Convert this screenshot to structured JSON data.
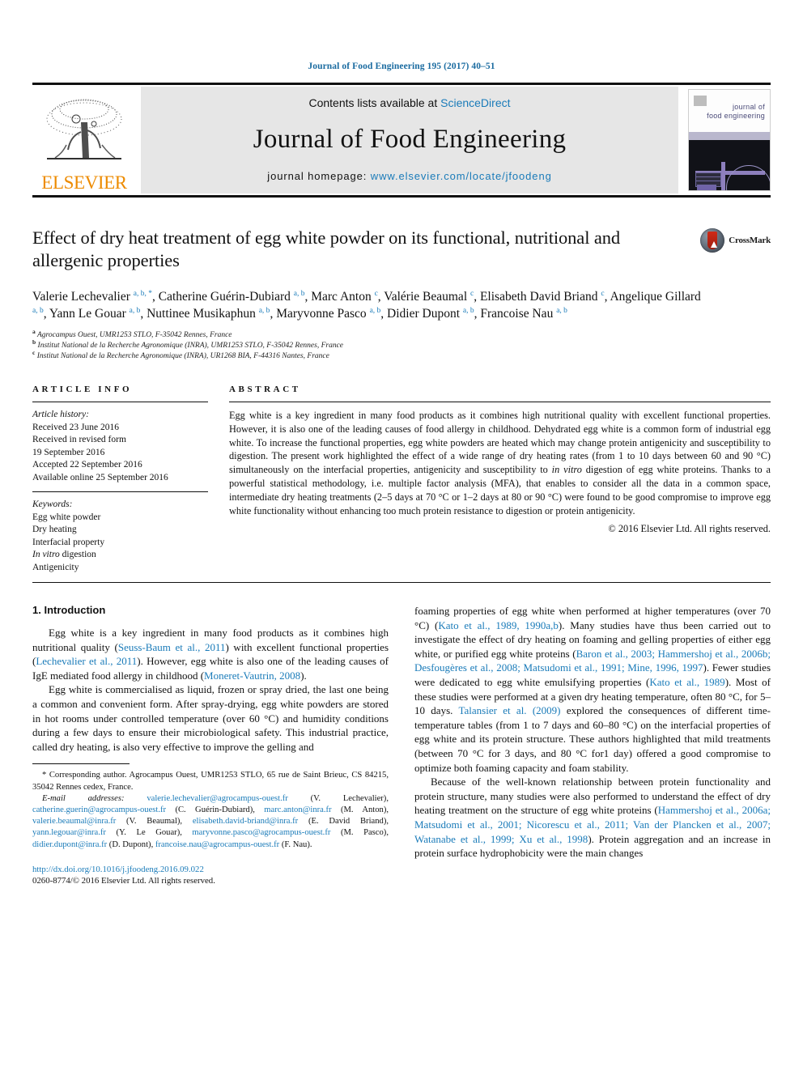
{
  "running_head": "Journal of Food Engineering 195 (2017) 40–51",
  "masthead": {
    "publisher_name": "ELSEVIER",
    "contents_prefix": "Contents lists available at ",
    "contents_link": "ScienceDirect",
    "journal_name": "Journal of Food Engineering",
    "homepage_prefix": "journal homepage: ",
    "homepage_url": "www.elsevier.com/locate/jfoodeng",
    "cover_title_line1": "journal of",
    "cover_title_line2": "food engineering"
  },
  "article": {
    "title": "Effect of dry heat treatment of egg white powder on its functional, nutritional and allergenic properties",
    "crossmark_label": "CrossMark",
    "authors_html": "Valerie Lechevalier <sup>a, b, *</sup>, Catherine Guérin-Dubiard <sup>a, b</sup>, Marc Anton <sup>c</sup>, Valérie Beaumal <sup>c</sup>, Elisabeth David Briand <sup>c</sup>, Angelique Gillard <sup>a, b</sup>, Yann Le Gouar <sup>a, b</sup>, Nuttinee Musikaphun <sup>a, b</sup>, Maryvonne Pasco <sup>a, b</sup>, Didier Dupont <sup>a, b</sup>, Francoise Nau <sup>a, b</sup>",
    "affiliations": [
      {
        "marker": "a",
        "text": "Agrocampus Ouest, UMR1253 STLO, F-35042 Rennes, France"
      },
      {
        "marker": "b",
        "text": "Institut National de la Recherche Agronomique (INRA), UMR1253 STLO, F-35042 Rennes, France"
      },
      {
        "marker": "c",
        "text": "Institut National de la Recherche Agronomique (INRA), UR1268 BIA, F-44316 Nantes, France"
      }
    ]
  },
  "article_info": {
    "heading": "ARTICLE INFO",
    "history_label": "Article history:",
    "history": [
      "Received 23 June 2016",
      "Received in revised form",
      "19 September 2016",
      "Accepted 22 September 2016",
      "Available online 25 September 2016"
    ],
    "keywords_label": "Keywords:",
    "keywords_html": [
      "Egg white powder",
      "Dry heating",
      "Interfacial property",
      "<span class=\"ital\">In vitro</span> digestion",
      "Antigenicity"
    ]
  },
  "abstract": {
    "heading": "ABSTRACT",
    "text_html": "Egg white is a key ingredient in many food products as it combines high nutritional quality with excellent functional properties. However, it is also one of the leading causes of food allergy in childhood. Dehydrated egg white is a common form of industrial egg white. To increase the functional properties, egg white powders are heated which may change protein antigenicity and susceptibility to digestion. The present work highlighted the effect of a wide range of dry heating rates (from 1 to 10 days between 60 and 90 °C) simultaneously on the interfacial properties, antigenicity and susceptibility to <span class=\"ital\">in vitro</span> digestion of egg white proteins. Thanks to a powerful statistical methodology, i.e. multiple factor analysis (MFA), that enables to consider all the data in a common space, intermediate dry heating treatments (2–5 days at 70 °C or 1–2 days at 80 or 90 °C) were found to be good compromise to improve egg white functionality without enhancing too much protein resistance to digestion or protein antigenicity.",
    "copyright": "© 2016 Elsevier Ltd. All rights reserved."
  },
  "body": {
    "section_title": "1. Introduction",
    "left_paragraphs_html": [
      "Egg white is a key ingredient in many food products as it combines high nutritional quality (<span class=\"cite\">Seuss-Baum et al., 2011</span>) with excellent functional properties (<span class=\"cite\">Lechevalier et al., 2011</span>). However, egg white is also one of the leading causes of IgE mediated food allergy in childhood (<span class=\"cite\">Moneret-Vautrin, 2008</span>).",
      "Egg white is commercialised as liquid, frozen or spray dried, the last one being a common and convenient form. After spray-drying, egg white powders are stored in hot rooms under controlled temperature (over 60 °C) and humidity conditions during a few days to ensure their microbiological safety. This industrial practice, called dry heating, is also very effective to improve the gelling and"
    ],
    "right_paragraphs_html": [
      "foaming properties of egg white when performed at higher temperatures (over 70 °C) (<span class=\"cite\">Kato et al., 1989, 1990a,b</span>). Many studies have thus been carried out to investigate the effect of dry heating on foaming and gelling properties of either egg white, or purified egg white proteins (<span class=\"cite\">Baron et al., 2003; Hammershoj et al., 2006b; Desfougères et al., 2008; Matsudomi et al., 1991; Mine, 1996, 1997</span>). Fewer studies were dedicated to egg white emulsifying properties (<span class=\"cite\">Kato et al., 1989</span>). Most of these studies were performed at a given dry heating temperature, often 80 °C, for 5–10 days. <span class=\"cite\">Talansier et al. (2009)</span> explored the consequences of different time-temperature tables (from 1 to 7 days and 60–80 °C) on the interfacial properties of egg white and its protein structure. These authors highlighted that mild treatments (between 70 °C for 3 days, and 80 °C for1 day) offered a good compromise to optimize both foaming capacity and foam stability.",
      "Because of the well-known relationship between protein functionality and protein structure, many studies were also performed to understand the effect of dry heating treatment on the structure of egg white proteins (<span class=\"cite\">Hammershoj et al., 2006a; Matsudomi et al., 2001; Nicorescu et al., 2011; Van der Plancken et al., 2007; Watanabe et al., 1999; Xu et al., 1998</span>). Protein aggregation and an increase in protein surface hydrophobicity were the main changes"
    ]
  },
  "footnote": {
    "corresponding_html": "* Corresponding author. Agrocampus Ouest, UMR1253 STLO, 65 rue de Saint Brieuc, CS 84215, 35042 Rennes cedex, France.",
    "emails_html": "<span class=\"ital\">E-mail addresses:</span> <span class=\"email-link\">valerie.lechevalier@agrocampus-ouest.fr</span> (V. Lechevalier), <span class=\"email-link\">catherine.guerin@agrocampus-ouest.fr</span> (C. Guérin-Dubiard), <span class=\"email-link\">marc.anton@inra.fr</span> (M. Anton), <span class=\"email-link\">valerie.beaumal@inra.fr</span> (V. Beaumal), <span class=\"email-link\">elisabeth.david-briand@inra.fr</span> (E. David Briand), <span class=\"email-link\">yann.legouar@inra.fr</span> (Y. Le Gouar), <span class=\"email-link\">maryvonne.pasco@agrocampus-ouest.fr</span> (M. Pasco), <span class=\"email-link\">didier.dupont@inra.fr</span> (D. Dupont), <span class=\"email-link\">francoise.nau@agrocampus-ouest.fr</span> (F. Nau).",
    "doi": "http://dx.doi.org/10.1016/j.jfoodeng.2016.09.022",
    "issn_copyright": "0260-8774/© 2016 Elsevier Ltd. All rights reserved."
  },
  "colors": {
    "link_blue": "#1a7bb9",
    "elsevier_orange": "#ed8b00",
    "panel_gray": "#e6e6e6"
  }
}
